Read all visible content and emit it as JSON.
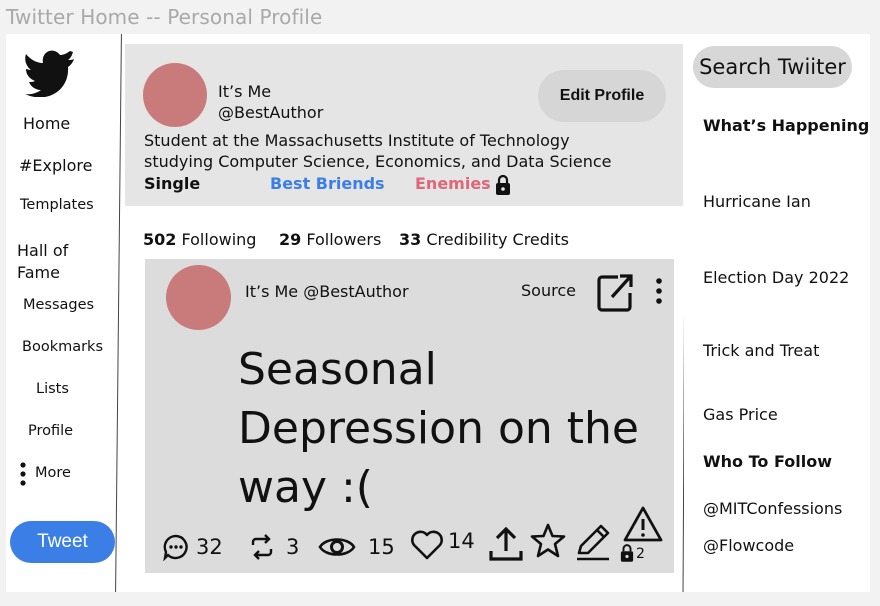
{
  "window": {
    "title": "Twitter Home -- Personal Profile"
  },
  "sidebar": {
    "items": [
      {
        "label": "Home"
      },
      {
        "label": "#Explore"
      },
      {
        "label": "Templates"
      },
      {
        "label": "Hall of Fame"
      },
      {
        "label": "Messages"
      },
      {
        "label": "Bookmarks"
      },
      {
        "label": "Lists"
      },
      {
        "label": "Profile"
      },
      {
        "label": "More"
      }
    ],
    "tweet_button": "Tweet"
  },
  "profile": {
    "display_name": "It’s Me",
    "handle": "@BestAuthor",
    "edit_button": "Edit Profile",
    "bio_line1": "Student at the Massachusetts Institute of Technology",
    "bio_line2": "studying Computer Science, Economics, and Data Science",
    "relationship": "Single",
    "best_friends": "Best Briends",
    "enemies": "Enemies",
    "stats": {
      "following_count": "502",
      "following_label": "Following",
      "followers_count": "29",
      "followers_label": "Followers",
      "credits_count": "33",
      "credits_label": "Credibility Credits"
    }
  },
  "post": {
    "author": "It’s Me @BestAuthor",
    "source_label": "Source",
    "text": "Seasonal Depression on the way :(",
    "actions": {
      "comments": "32",
      "retweets": "3",
      "views": "15",
      "likes": "14",
      "warnings": "2"
    }
  },
  "right": {
    "search_placeholder": "Search Twiiter",
    "whats_happening": "What’s Happening",
    "trends": [
      "Hurricane Ian",
      "Election Day 2022",
      "Trick and Treat",
      "Gas Price"
    ],
    "who_to_follow": "Who To Follow",
    "follow_suggestions": [
      "@MITConfessions",
      "@Flowcode"
    ]
  },
  "colors": {
    "accent_blue": "#3b7fe6",
    "best_friends": "#3b7fe6",
    "enemies": "#e0667a",
    "avatar": "#c97a7a",
    "profile_card": "#e5e5e5",
    "post_card": "#dcdcdc"
  },
  "icons": [
    "twitter-bird-icon",
    "more-dots-icon",
    "lock-icon",
    "external-link-icon",
    "kebab-menu-icon",
    "comment-icon",
    "retweet-icon",
    "eye-icon",
    "heart-icon",
    "share-icon",
    "star-icon",
    "edit-icon",
    "warning-icon"
  ]
}
